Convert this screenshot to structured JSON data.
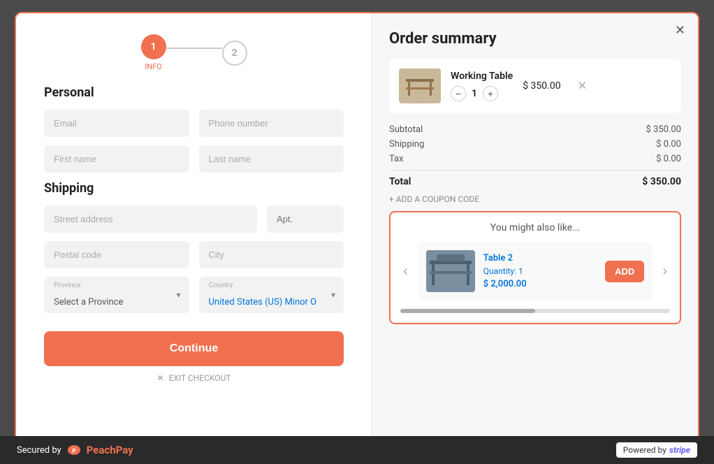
{
  "modal": {
    "close_label": "✕"
  },
  "stepper": {
    "step1": {
      "number": "1",
      "label": "INFO"
    },
    "step2": {
      "number": "2"
    }
  },
  "personal": {
    "heading": "Personal",
    "email_placeholder": "Email",
    "phone_placeholder": "Phone number",
    "firstname_placeholder": "First name",
    "lastname_placeholder": "Last name"
  },
  "shipping": {
    "heading": "Shipping",
    "street_placeholder": "Street address",
    "apt_placeholder": "Apt.",
    "postal_placeholder": "Postal code",
    "city_placeholder": "City",
    "province_label": "Province",
    "province_value": "Select a Province",
    "country_label": "Country",
    "country_value": "United States (US) Minor O"
  },
  "actions": {
    "continue_label": "Continue",
    "exit_label": "EXIT CHECKOUT"
  },
  "order_summary": {
    "title": "Order summary",
    "product": {
      "name": "Working Table",
      "price": "$ 350.00",
      "qty": "1"
    },
    "subtotal_label": "Subtotal",
    "subtotal_value": "$ 350.00",
    "shipping_label": "Shipping",
    "shipping_value": "$ 0.00",
    "tax_label": "Tax",
    "tax_value": "$ 0.00",
    "total_label": "Total",
    "total_value": "$ 350.00",
    "coupon_label": "+ ADD A COUPON CODE"
  },
  "upsell": {
    "title": "You might also like...",
    "product": {
      "name": "Table 2",
      "qty_label": "Quantity:",
      "qty": "1",
      "price": "$ 2,000.00"
    },
    "add_label": "ADD"
  },
  "footer": {
    "secured_label": "Secured by",
    "brand": "PeachPay",
    "powered_label": "Powered by",
    "stripe_label": "stripe"
  }
}
